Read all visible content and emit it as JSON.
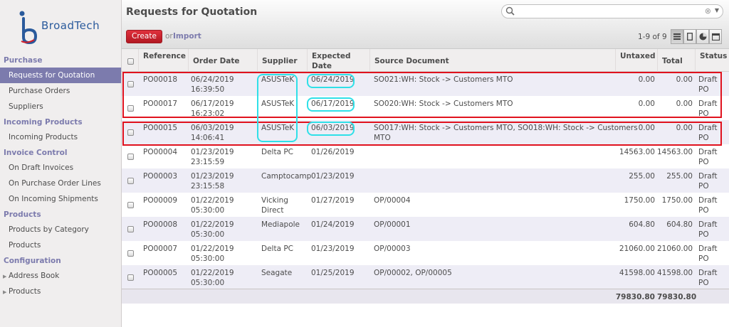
{
  "brand": {
    "name": "BroadTech"
  },
  "sidebar": {
    "sections": [
      {
        "title": "Purchase",
        "items": [
          "Requests for Quotation",
          "Purchase Orders",
          "Suppliers"
        ]
      },
      {
        "title": "Incoming Products",
        "items": [
          "Incoming Products"
        ]
      },
      {
        "title": "Invoice Control",
        "items": [
          "On Draft Invoices",
          "On Purchase Order Lines",
          "On Incoming Shipments"
        ]
      },
      {
        "title": "Products",
        "items": [
          "Products by Category",
          "Products"
        ]
      },
      {
        "title": "Configuration",
        "items": [
          "Address Book",
          "Products"
        ]
      }
    ]
  },
  "header": {
    "title": "Requests for Quotation",
    "search_placeholder": "",
    "create_label": "Create",
    "or_label": "or",
    "import_label": "Import",
    "pager": "1-9 of 9"
  },
  "table": {
    "columns": [
      "Reference",
      "Order Date",
      "Supplier",
      "Expected Date",
      "Source Document",
      "Untaxed",
      "Total",
      "Status"
    ],
    "rows": [
      {
        "ref": "PO00018",
        "date": "06/24/2019",
        "time": "16:39:50",
        "supplier": [
          "ASUSTeK"
        ],
        "expected": "06/24/2019",
        "source": [
          "SO021:WH: Stock -> Customers MTO"
        ],
        "untaxed": "0.00",
        "total": "0.00",
        "status": [
          "Draft",
          "PO"
        ]
      },
      {
        "ref": "PO00017",
        "date": "06/17/2019",
        "time": "16:23:02",
        "supplier": [
          "ASUSTeK"
        ],
        "expected": "06/17/2019",
        "source": [
          "SO020:WH: Stock -> Customers MTO"
        ],
        "untaxed": "0.00",
        "total": "0.00",
        "status": [
          "Draft",
          "PO"
        ]
      },
      {
        "ref": "PO00015",
        "date": "06/03/2019",
        "time": "14:06:41",
        "supplier": [
          "ASUSTeK"
        ],
        "expected": "06/03/2019",
        "source": [
          "SO017:WH: Stock -> Customers MTO, SO018:WH: Stock -> Customers",
          "MTO"
        ],
        "untaxed": "0.00",
        "total": "0.00",
        "status": [
          "Draft",
          "PO"
        ]
      },
      {
        "ref": "PO00004",
        "date": "01/23/2019",
        "time": "23:15:59",
        "supplier": [
          "Delta PC"
        ],
        "expected": "01/26/2019",
        "source": [
          ""
        ],
        "untaxed": "14563.00",
        "total": "14563.00",
        "status": [
          "Draft",
          "PO"
        ]
      },
      {
        "ref": "PO00003",
        "date": "01/23/2019",
        "time": "23:15:58",
        "supplier": [
          "Camptocamp"
        ],
        "expected": "01/23/2019",
        "source": [
          ""
        ],
        "untaxed": "255.00",
        "total": "255.00",
        "status": [
          "Draft",
          "PO"
        ]
      },
      {
        "ref": "PO00009",
        "date": "01/22/2019",
        "time": "05:30:00",
        "supplier": [
          "Vicking",
          "Direct"
        ],
        "expected": "01/27/2019",
        "source": [
          "OP/00004"
        ],
        "untaxed": "1750.00",
        "total": "1750.00",
        "status": [
          "Draft",
          "PO"
        ]
      },
      {
        "ref": "PO00008",
        "date": "01/22/2019",
        "time": "05:30:00",
        "supplier": [
          "Mediapole"
        ],
        "expected": "01/24/2019",
        "source": [
          "OP/00001"
        ],
        "untaxed": "604.80",
        "total": "604.80",
        "status": [
          "Draft",
          "PO"
        ]
      },
      {
        "ref": "PO00007",
        "date": "01/22/2019",
        "time": "05:30:00",
        "supplier": [
          "Delta PC"
        ],
        "expected": "01/23/2019",
        "source": [
          "OP/00003"
        ],
        "untaxed": "21060.00",
        "total": "21060.00",
        "status": [
          "Draft",
          "PO"
        ]
      },
      {
        "ref": "PO00005",
        "date": "01/22/2019",
        "time": "05:30:00",
        "supplier": [
          "Seagate"
        ],
        "expected": "01/25/2019",
        "source": [
          "OP/00002, OP/00005"
        ],
        "untaxed": "41598.00",
        "total": "41598.00",
        "status": [
          "Draft",
          "PO"
        ]
      }
    ],
    "totals": {
      "untaxed": "79830.80",
      "total": "79830.80"
    }
  },
  "colors": {
    "accent": "#7c7bad",
    "create": "#c4202a",
    "highlight_red": "#e0121e",
    "highlight_cyan": "#2fe0e8"
  }
}
